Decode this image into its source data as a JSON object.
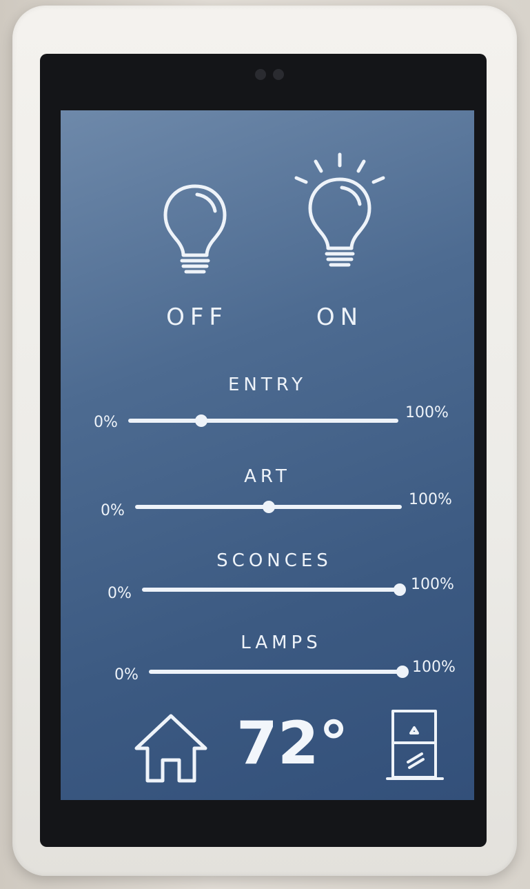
{
  "lights": {
    "off_label": "OFF",
    "on_label": "ON",
    "off_icon": "lightbulb-off-icon",
    "on_icon": "lightbulb-on-icon"
  },
  "sliders": [
    {
      "name": "ENTRY",
      "min_label": "0%",
      "max_label": "100%",
      "level": 0.27
    },
    {
      "name": "ART",
      "min_label": "0%",
      "max_label": "100%",
      "level": 0.5
    },
    {
      "name": "SCONCES",
      "min_label": "0%",
      "max_label": "100%",
      "level": 1.0
    },
    {
      "name": "LAMPS",
      "min_label": "0%",
      "max_label": "100%",
      "level": 1.0
    }
  ],
  "footer": {
    "home_icon": "home-icon",
    "temperature": "72°",
    "window_icon": "window-icon"
  },
  "colors": {
    "screen": "#4d6b91",
    "foreground": "#eef3f9"
  }
}
